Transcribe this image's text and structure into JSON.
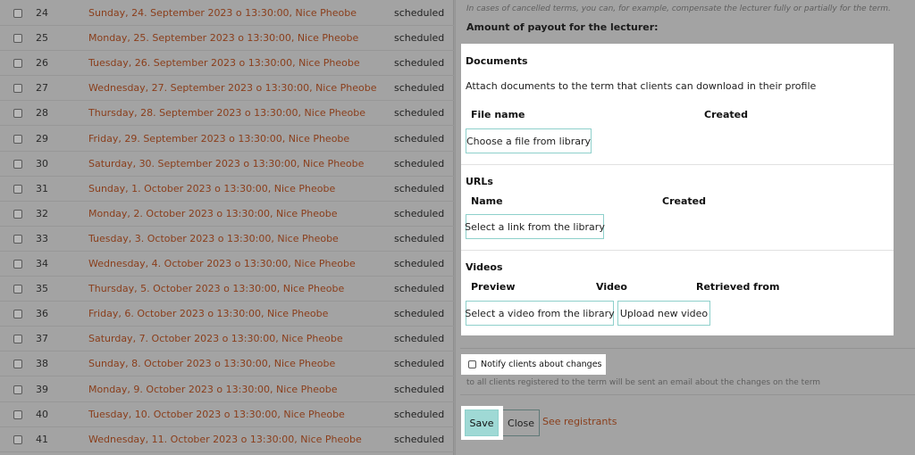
{
  "terms": [
    {
      "num": "24",
      "label": "Sunday, 24. September 2023 o 13:30:00, Nice Pheobe",
      "status": "scheduled"
    },
    {
      "num": "25",
      "label": "Monday, 25. September 2023 o 13:30:00, Nice Pheobe",
      "status": "scheduled"
    },
    {
      "num": "26",
      "label": "Tuesday, 26. September 2023 o 13:30:00, Nice Pheobe",
      "status": "scheduled"
    },
    {
      "num": "27",
      "label": "Wednesday, 27. September 2023 o 13:30:00, Nice Pheobe",
      "status": "scheduled"
    },
    {
      "num": "28",
      "label": "Thursday, 28. September 2023 o 13:30:00, Nice Pheobe",
      "status": "scheduled"
    },
    {
      "num": "29",
      "label": "Friday, 29. September 2023 o 13:30:00, Nice Pheobe",
      "status": "scheduled"
    },
    {
      "num": "30",
      "label": "Saturday, 30. September 2023 o 13:30:00, Nice Pheobe",
      "status": "scheduled"
    },
    {
      "num": "31",
      "label": "Sunday, 1. October 2023 o 13:30:00, Nice Pheobe",
      "status": "scheduled"
    },
    {
      "num": "32",
      "label": "Monday, 2. October 2023 o 13:30:00, Nice Pheobe",
      "status": "scheduled"
    },
    {
      "num": "33",
      "label": "Tuesday, 3. October 2023 o 13:30:00, Nice Pheobe",
      "status": "scheduled"
    },
    {
      "num": "34",
      "label": "Wednesday, 4. October 2023 o 13:30:00, Nice Pheobe",
      "status": "scheduled"
    },
    {
      "num": "35",
      "label": "Thursday, 5. October 2023 o 13:30:00, Nice Pheobe",
      "status": "scheduled"
    },
    {
      "num": "36",
      "label": "Friday, 6. October 2023 o 13:30:00, Nice Pheobe",
      "status": "scheduled"
    },
    {
      "num": "37",
      "label": "Saturday, 7. October 2023 o 13:30:00, Nice Pheobe",
      "status": "scheduled"
    },
    {
      "num": "38",
      "label": "Sunday, 8. October 2023 o 13:30:00, Nice Pheobe",
      "status": "scheduled"
    },
    {
      "num": "39",
      "label": "Monday, 9. October 2023 o 13:30:00, Nice Pheobe",
      "status": "scheduled"
    },
    {
      "num": "40",
      "label": "Tuesday, 10. October 2023 o 13:30:00, Nice Pheobe",
      "status": "scheduled"
    },
    {
      "num": "41",
      "label": "Wednesday, 11. October 2023 o 13:30:00, Nice Pheobe",
      "status": "scheduled"
    }
  ],
  "payout": {
    "note": "In cases of cancelled terms, you can, for example, compensate the lecturer fully or partially for the term.",
    "heading": "Amount of payout for the lecturer:"
  },
  "documents": {
    "title": "Documents",
    "description": "Attach documents to the term that clients can download in their profile",
    "col_file_name": "File name",
    "col_created": "Created",
    "choose_button": "Choose a file from library"
  },
  "urls": {
    "title": "URLs",
    "col_name": "Name",
    "col_created": "Created",
    "select_button": "Select a link from the library"
  },
  "videos": {
    "title": "Videos",
    "col_preview": "Preview",
    "col_video": "Video",
    "col_retrieved": "Retrieved from",
    "select_button": "Select a video from the library",
    "upload_button": "Upload new video"
  },
  "notify": {
    "label": "Notify clients about changes",
    "description": "to all clients registered to the term will be sent an email about the changes on the term"
  },
  "actions": {
    "save": "Save",
    "close": "Close",
    "registrants": "See registrants"
  },
  "colors": {
    "accent": "#9fd9d5",
    "accent_border": "#8ed0cb",
    "link": "#c05a2a"
  }
}
